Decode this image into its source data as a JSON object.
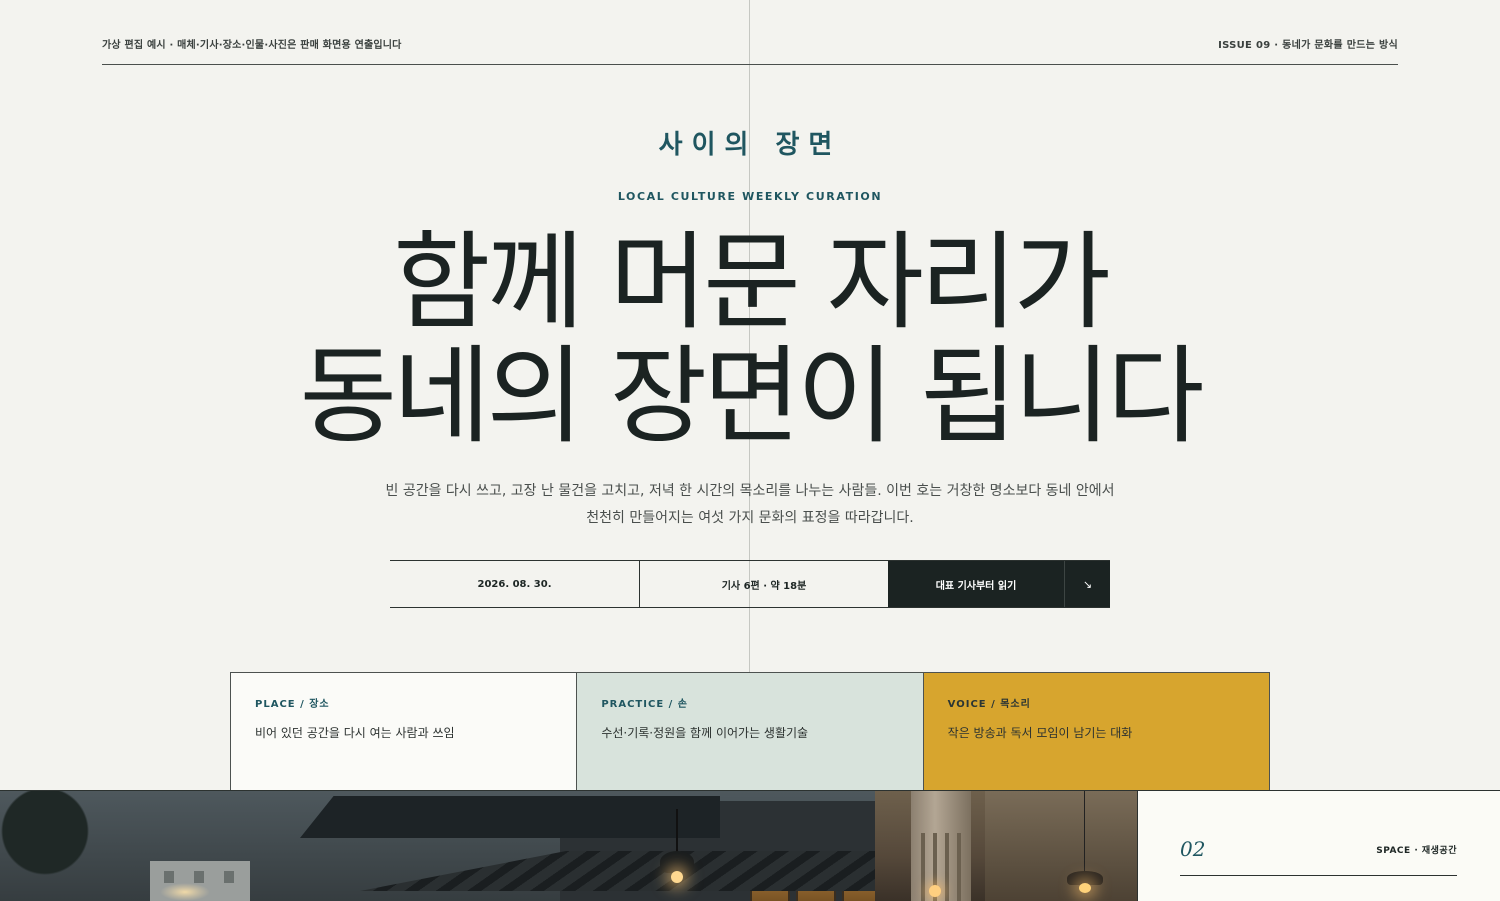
{
  "header": {
    "disclaimer": "가상 편집 예시 · 매체·기사·장소·인물·사진은 판매 화면용 연출입니다",
    "issue": "ISSUE 09 · 동네가 문화를 만드는 방식"
  },
  "masthead": {
    "brand": "사이의 장면",
    "eyebrow": "LOCAL CULTURE WEEKLY CURATION"
  },
  "hero": {
    "headline_line1": "함께 머문 자리가",
    "headline_line2": "동네의 장면이 됩니다",
    "lede_line1": "빈 공간을 다시 쓰고, 고장 난 물건을 고치고, 저녁 한 시간의 목소리를 나누는 사람들. 이번 호는 거창한 명소보다 동네 안에서",
    "lede_line2": "천천히 만들어지는 여섯 가지 문화의 표정을 따라갑니다."
  },
  "meta": {
    "date": "2026. 08. 30.",
    "count": "기사 6편 · 약 18분",
    "cta_label": "대표 기사부터 읽기",
    "cta_arrow": "↘"
  },
  "categories": [
    {
      "label": "PLACE / 장소",
      "desc": "비어 있던 공간을 다시 여는 사람과 쓰임"
    },
    {
      "label": "PRACTICE / 손",
      "desc": "수선·기록·정원을 함께 이어가는 생활기술"
    },
    {
      "label": "VOICE / 목소리",
      "desc": "작은 방송과 독서 모임이 남기는 대화"
    }
  ],
  "feature": {
    "number": "02",
    "label": "SPACE · 재생공간"
  },
  "colors": {
    "background": "#f3f3ef",
    "accent_teal": "#1f5660",
    "dark": "#1b2322",
    "practice_bg": "#d8e3dc",
    "voice_bg": "#d7a52e"
  }
}
